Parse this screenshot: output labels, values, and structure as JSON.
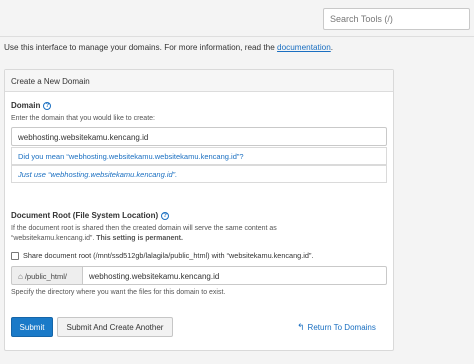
{
  "search": {
    "placeholder": "Search Tools (/)"
  },
  "intro": {
    "text": "Use this interface to manage your domains. For more information, read the ",
    "link": "documentation",
    "suffix": "."
  },
  "panel": {
    "title": "Create a New Domain",
    "domain": {
      "label": "Domain",
      "hint": "Enter the domain that you would like to create:",
      "value": "webhosting.websitekamu.kencang.id",
      "suggestion": "Did you mean “webhosting.websitekamu.websitekamu.kencang.id”?",
      "just_use": "Just use “webhosting.websitekamu.kencang.id”."
    },
    "docroot": {
      "label": "Document Root (File System Location)",
      "hint_line1": "If the document root is shared then the created domain will serve the same content as",
      "hint_line2_plain": "“websitekamu.kencang.id”. ",
      "hint_line2_bold": "This setting is permanent.",
      "share_label": "Share document root (/mnt/ssd512gb/lalagila/public_html) with “websitekamu.kencang.id”.",
      "share_checked": false,
      "prefix": "/public_html/",
      "value": "webhosting.websitekamu.kencang.id",
      "specify_hint": "Specify the directory where you want the files for this domain to exist."
    },
    "buttons": {
      "submit": "Submit",
      "submit_another": "Submit And Create Another",
      "return": "Return To Domains"
    }
  },
  "colors": {
    "accent": "#1a7ac8",
    "link": "#1a6fc1"
  },
  "icons": {
    "help": "help-circle-icon",
    "home": "home-icon",
    "return": "return-arrow-icon"
  }
}
